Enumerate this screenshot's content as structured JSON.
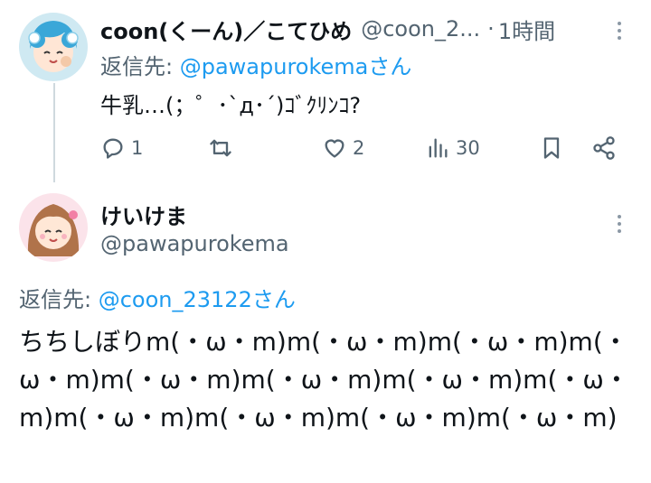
{
  "tweet1": {
    "author_name": "coon(くーん)／こてひめ",
    "author_handle": "@coon_2...",
    "separator": "·",
    "time": "1時間",
    "reply_to_prefix": "返信先: ",
    "reply_to_handle": "@pawapurokema",
    "reply_to_suffix": "さん",
    "text": "牛乳…(；゜･`д･´)ｺﾞｸﾘﾝｺ?",
    "actions": {
      "reply_count": "1",
      "retweet_count": "",
      "like_count": "2",
      "views_count": "30"
    }
  },
  "tweet2": {
    "author_name": "けいけま",
    "author_handle": "@pawapurokema",
    "reply_to_prefix": "返信先: ",
    "reply_to_handle": "@coon_23122",
    "reply_to_suffix": "さん",
    "text": "ちちしぼりm(・ω・m)m(・ω・m)m(・ω・m)m(・ω・m)m(・ω・m)m(・ω・m)m(・ω・m)m(・ω・m)m(・ω・m)m(・ω・m)m(・ω・m)m(・ω・m)"
  },
  "icons": {
    "reply": "reply-icon",
    "retweet": "retweet-icon",
    "like": "heart-icon",
    "views": "views-chart-icon",
    "bookmark": "bookmark-icon",
    "share": "share-icon",
    "more": "more-vertical-icon"
  },
  "colors": {
    "text_primary": "#0f1419",
    "text_secondary": "#536471",
    "link": "#1d9bf0",
    "thread_line": "#cfd9de"
  }
}
